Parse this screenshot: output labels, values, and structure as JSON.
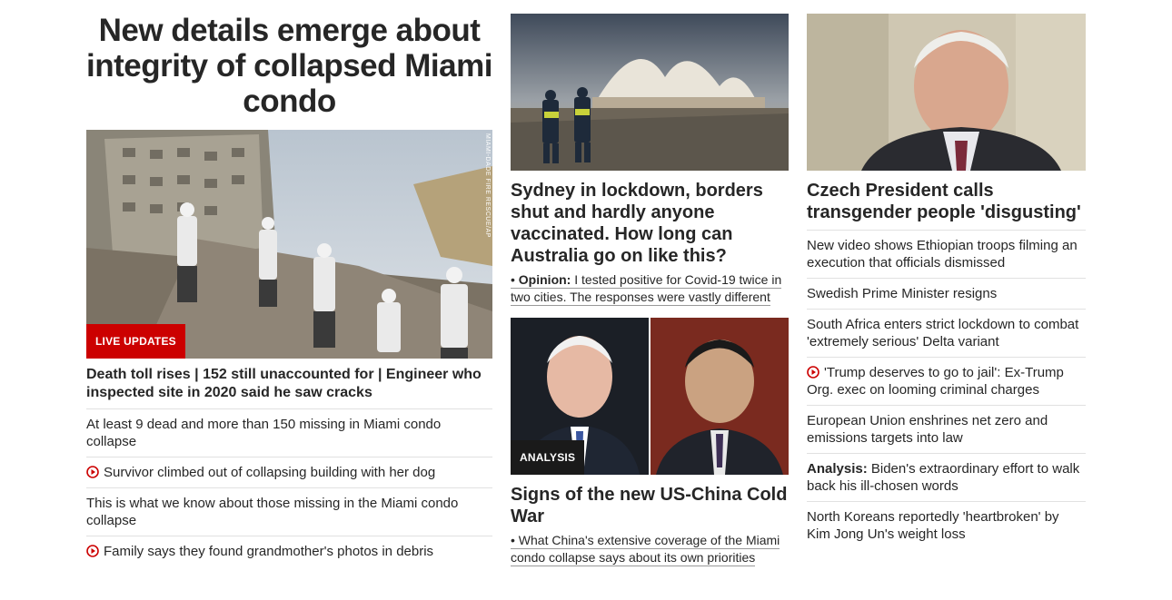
{
  "col1": {
    "title": "New details emerge about integrity of collapsed Miami condo",
    "image_credit": "MIAMI-DADE FIRE RESCUE/AP",
    "badge": "LIVE UPDATES",
    "lead": "Death toll rises | 152 still unaccounted for | Engineer who inspected site in 2020 said he saw cracks",
    "items": [
      {
        "video": false,
        "text": "At least 9 dead and more than 150 missing in Miami condo collapse"
      },
      {
        "video": true,
        "text": "Survivor climbed out of collapsing building with her dog"
      },
      {
        "video": false,
        "text": "This is what we know about those missing in the Miami condo collapse"
      },
      {
        "video": true,
        "text": "Family says they found grandmother's photos in debris"
      }
    ]
  },
  "col2": {
    "story1": {
      "headline": "Sydney in lockdown, borders shut and hardly anyone vaccinated. How long can Australia go on like this?",
      "sub_prefix": "Opinion:",
      "sub_text": "I tested positive for Covid-19 twice in two cities. The responses were vastly different"
    },
    "story2": {
      "badge": "ANALYSIS",
      "headline": "Signs of the new US-China Cold War",
      "sub_text": "What China's extensive coverage of the Miami condo collapse says about its own priorities"
    }
  },
  "col3": {
    "headline": "Czech President calls transgender people 'disgusting'",
    "items": [
      {
        "video": false,
        "prefix": "",
        "text": "New video shows Ethiopian troops filming an execution that officials dismissed"
      },
      {
        "video": false,
        "prefix": "",
        "text": "Swedish Prime Minister resigns"
      },
      {
        "video": false,
        "prefix": "",
        "text": "South Africa enters strict lockdown to combat 'extremely serious' Delta variant"
      },
      {
        "video": true,
        "prefix": "",
        "text": "'Trump deserves to go to jail': Ex-Trump Org. exec on looming criminal charges"
      },
      {
        "video": false,
        "prefix": "",
        "text": "European Union enshrines net zero and emissions targets into law"
      },
      {
        "video": false,
        "prefix": "Analysis:",
        "text": "Biden's extraordinary effort to walk back his ill-chosen words"
      },
      {
        "video": false,
        "prefix": "",
        "text": "North Koreans reportedly 'heartbroken' by Kim Jong Un's weight loss"
      }
    ]
  },
  "colors": {
    "accent_red": "#cc0000",
    "text": "#262626",
    "divider": "#e1e1e1"
  }
}
